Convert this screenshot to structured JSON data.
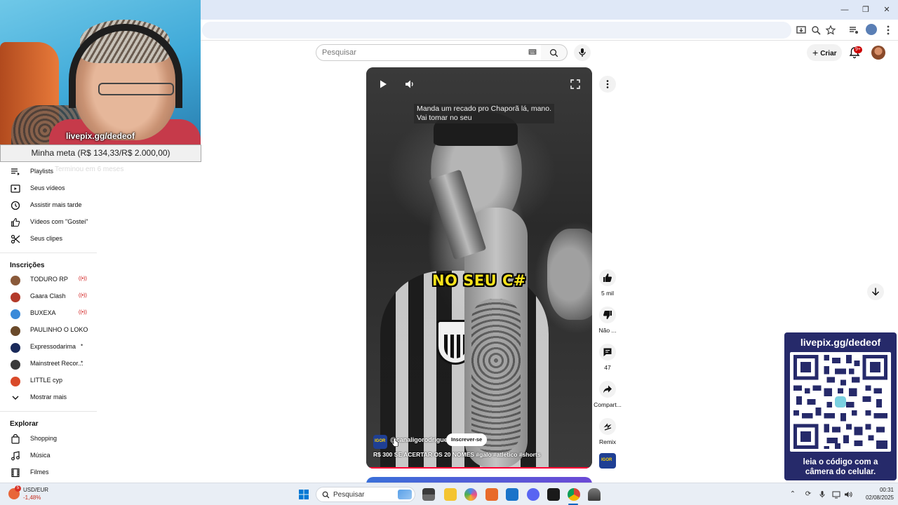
{
  "browser": {
    "minimize_label": "—",
    "restore_label": "❐",
    "close_label": "✕"
  },
  "masthead": {
    "search_placeholder": "Pesquisar",
    "create_label": "Criar",
    "notification_count": "9+"
  },
  "stream_overlay": {
    "webcam_handle": "livepix.gg/dedeof",
    "goal_text": "Minha meta (R$ 134,33/R$ 2.000,00)",
    "ghost_text": "Terminou em 6 meses"
  },
  "sidebar": {
    "you_items": [
      {
        "label": "Playlists",
        "icon": "playlist-icon"
      },
      {
        "label": "Seus vídeos",
        "icon": "video-icon"
      },
      {
        "label": "Assistir mais tarde",
        "icon": "clock-icon"
      },
      {
        "label": "Vídeos com \"Gostei\"",
        "icon": "thumbs-up-icon"
      },
      {
        "label": "Seus clipes",
        "icon": "scissors-icon"
      }
    ],
    "subscriptions_heading": "Inscrições",
    "subscriptions": [
      {
        "label": "TODURO RP",
        "status": "live",
        "color": "#8a5a3a"
      },
      {
        "label": "Gaara Clash",
        "status": "live",
        "color": "#b33a2a"
      },
      {
        "label": "BUXEXA",
        "status": "live",
        "color": "#3a8ad9"
      },
      {
        "label": "PAULINHO O LOKO",
        "status": "none",
        "color": "#6a4a2a"
      },
      {
        "label": "Expressodarima",
        "status": "new",
        "color": "#1a2a5a"
      },
      {
        "label": "Mainstreet Recor...",
        "status": "new",
        "color": "#3a3a3a"
      },
      {
        "label": "LITTLE cyp",
        "status": "none",
        "color": "#d94a2a"
      }
    ],
    "show_more_label": "Mostrar mais",
    "explore_heading": "Explorar",
    "explore_items": [
      {
        "label": "Shopping",
        "icon": "shopping-bag-icon"
      },
      {
        "label": "Música",
        "icon": "music-note-icon"
      },
      {
        "label": "Filmes",
        "icon": "film-icon"
      }
    ]
  },
  "short": {
    "caption_lines": [
      "Manda um recado pro Chaporã lá, mano.",
      "Vai tomar no seu"
    ],
    "overlay_text": "NO SEU C#",
    "channel_name": "@canaligorodrigues",
    "channel_avatar_text": "IGOR",
    "subscribe_label": "Inscrever-se",
    "title": "R$ 300 SE ACERTAR OS 20 NOMES #galo #atletico #shorts",
    "progress_color": "#ff0033"
  },
  "actions": {
    "like_count": "5 mil",
    "dislike_label": "Não ...",
    "comment_count": "47",
    "share_label": "Compart...",
    "remix_label": "Remix"
  },
  "qr_overlay": {
    "title": "livepix.gg/dedeof",
    "caption_line1": "leia o código com a",
    "caption_line2": "câmera do celular."
  },
  "taskbar": {
    "stock_name": "USD/EUR",
    "stock_change": "-1,48%",
    "stock_badge": "5",
    "search_label": "Pesquisar",
    "time": "00:31",
    "date": "02/08/2025"
  }
}
